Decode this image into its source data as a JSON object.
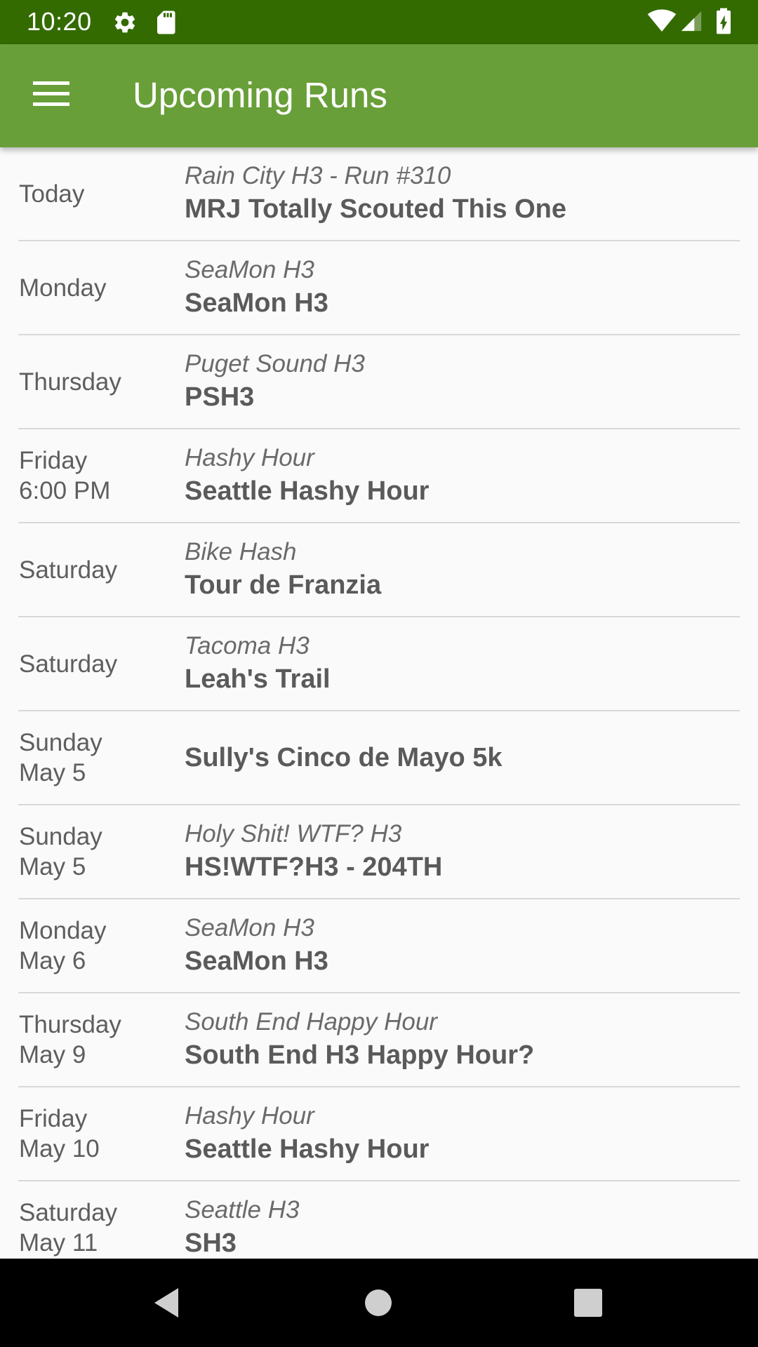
{
  "status_bar": {
    "time": "10:20",
    "icons": [
      "gear-icon",
      "sd-card-icon",
      "wifi-icon",
      "cell-signal-icon",
      "battery-charging-icon"
    ]
  },
  "app_bar": {
    "menu_icon": "hamburger-menu-icon",
    "title": "Upcoming Runs",
    "color": "#689f38",
    "status_color": "#336b00"
  },
  "runs": [
    {
      "day": "Today",
      "date": "",
      "kennel": "Rain City H3  - Run #310",
      "name": "MRJ Totally Scouted This One"
    },
    {
      "day": "Monday",
      "date": "",
      "kennel": "SeaMon H3",
      "name": "SeaMon H3"
    },
    {
      "day": "Thursday",
      "date": "",
      "kennel": "Puget Sound H3",
      "name": "PSH3"
    },
    {
      "day": "Friday",
      "date": "6:00 PM",
      "kennel": "Hashy Hour",
      "name": "Seattle Hashy Hour"
    },
    {
      "day": "Saturday",
      "date": "",
      "kennel": "Bike Hash",
      "name": "Tour de Franzia"
    },
    {
      "day": "Saturday",
      "date": "",
      "kennel": "Tacoma H3",
      "name": "Leah's Trail"
    },
    {
      "day": "Sunday",
      "date": "May 5",
      "kennel": "",
      "name": "Sully's Cinco de Mayo 5k"
    },
    {
      "day": "Sunday",
      "date": "May 5",
      "kennel": "Holy Shit! WTF? H3",
      "name": "HS!WTF?H3 - 204TH"
    },
    {
      "day": "Monday",
      "date": "May 6",
      "kennel": "SeaMon H3",
      "name": "SeaMon H3"
    },
    {
      "day": "Thursday",
      "date": "May 9",
      "kennel": "South End Happy Hour",
      "name": "South End H3 Happy Hour?"
    },
    {
      "day": "Friday",
      "date": "May 10",
      "kennel": "Hashy Hour",
      "name": "Seattle Hashy Hour"
    },
    {
      "day": "Saturday",
      "date": "May 11",
      "kennel": "Seattle H3",
      "name": "SH3"
    }
  ],
  "nav_bar": {
    "buttons": [
      "back-icon",
      "home-icon",
      "recents-icon"
    ]
  }
}
